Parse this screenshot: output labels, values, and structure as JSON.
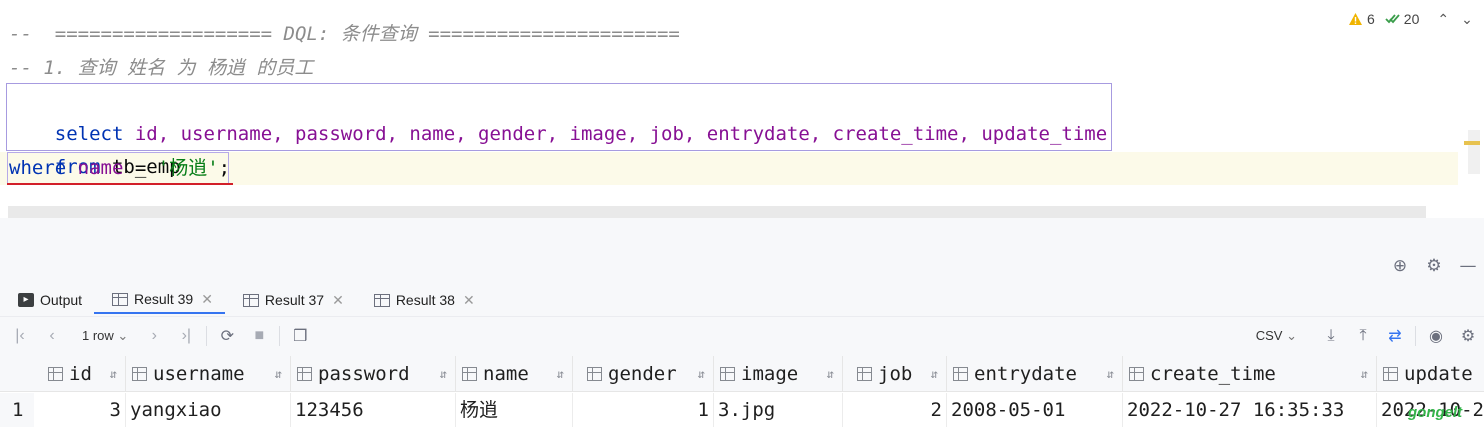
{
  "editor": {
    "lines": [
      {
        "comment": "--  =================== DQL: 条件查询 ======================"
      },
      {
        "comment": "-- 1. 查询 姓名 为 杨逍 的员工"
      },
      {
        "kw": "select",
        "fields": "id, username, password, name, gender, image, job, entrydate, create_time, update_time"
      },
      {
        "kw": "from",
        "table": "tb_emp"
      },
      {
        "kw": "where",
        "field": "name",
        "op": " = ",
        "str": "'杨逍'",
        "end": ";"
      }
    ],
    "warnings": "6",
    "checks": "20",
    "colors": {
      "keyword": "#0033b3",
      "field": "#871094",
      "string": "#067d17",
      "comment": "#8c8c8c"
    }
  },
  "results": {
    "tabs": [
      {
        "label": "Output",
        "icon": "output-icon"
      },
      {
        "label": "Result 39",
        "icon": "table-icon",
        "active": true
      },
      {
        "label": "Result 37",
        "icon": "table-icon"
      },
      {
        "label": "Result 38",
        "icon": "table-icon"
      }
    ],
    "toolbar": {
      "rows": "1 row",
      "export_format": "CSV"
    },
    "columns": [
      "id",
      "username",
      "password",
      "name",
      "gender",
      "image",
      "job",
      "entrydate",
      "create_time",
      "update"
    ],
    "rows": [
      {
        "num": "1",
        "cells": [
          "3",
          "yangxiao",
          "123456",
          "杨逍",
          "1",
          "3.jpg",
          "2",
          "2008-05-01",
          "2022-10-27 16:35:33",
          "2022-10-2"
        ]
      }
    ]
  },
  "watermark": "gongelt"
}
